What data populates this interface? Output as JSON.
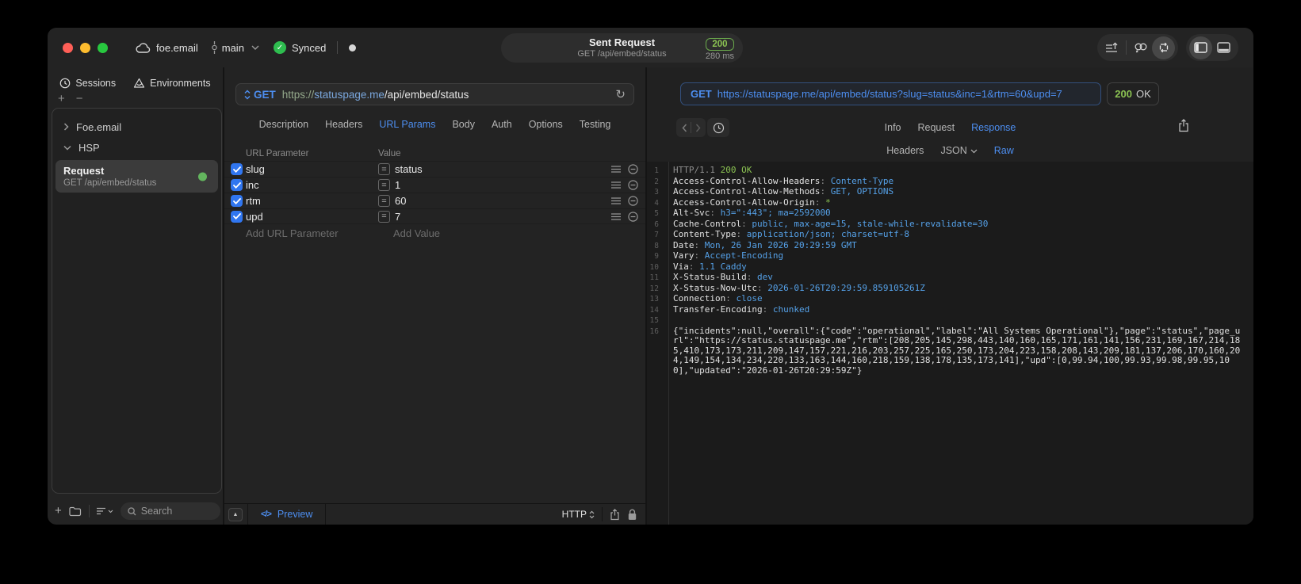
{
  "titlebar": {
    "project_name": "foe.email",
    "branch_name": "main",
    "sync_label": "Synced",
    "request_title": "Sent Request",
    "request_subtitle": "GET /api/embed/status",
    "status_code": "200",
    "duration": "280 ms"
  },
  "sidebar": {
    "tabs": [
      {
        "label": "Sessions"
      },
      {
        "label": "Environments"
      }
    ],
    "tree": [
      {
        "label": "Foe.email",
        "expanded": false
      },
      {
        "label": "HSP",
        "expanded": true
      }
    ],
    "request_item": {
      "title": "Request",
      "subtitle": "GET /api/embed/status"
    },
    "search_placeholder": "Search"
  },
  "request_editor": {
    "method": "GET",
    "url": {
      "scheme": "https://",
      "host": "statuspage.me",
      "path": "/api/embed/status"
    },
    "tabs": [
      "Description",
      "Headers",
      "URL Params",
      "Body",
      "Auth",
      "Options",
      "Testing"
    ],
    "active_tab": "URL Params",
    "params_table": {
      "columns": [
        "URL Parameter",
        "Value"
      ],
      "rows": [
        {
          "name": "slug",
          "value": "status",
          "checked": true
        },
        {
          "name": "inc",
          "value": "1",
          "checked": true
        },
        {
          "name": "rtm",
          "value": "60",
          "checked": true
        },
        {
          "name": "upd",
          "value": "7",
          "checked": true
        }
      ],
      "add_name_placeholder": "Add URL Parameter",
      "add_value_placeholder": "Add Value"
    },
    "footer": {
      "preview_label": "Preview",
      "code_glyph": "</>",
      "protocol_label": "HTTP"
    }
  },
  "response_viewer": {
    "request_line": {
      "method": "GET",
      "url": "https://statuspage.me/api/embed/status?slug=status&inc=1&rtm=60&upd=7"
    },
    "status_code": "200",
    "status_text": "OK",
    "tabs": [
      "Info",
      "Request",
      "Response"
    ],
    "active_tab": "Response",
    "view_tabs": [
      "Headers",
      "JSON",
      "Raw"
    ],
    "active_view_tab": "Raw",
    "body_lines": [
      {
        "n": "1",
        "segs": [
          {
            "t": "HTTP/1.1 ",
            "c": "dim"
          },
          {
            "t": "200 OK",
            "c": "green"
          }
        ]
      },
      {
        "n": "2",
        "segs": [
          {
            "t": "Access-Control-Allow-Headers",
            "c": "key"
          },
          {
            "t": ": ",
            "c": "dim"
          },
          {
            "t": "Content-Type",
            "c": "val"
          }
        ]
      },
      {
        "n": "3",
        "segs": [
          {
            "t": "Access-Control-Allow-Methods",
            "c": "key"
          },
          {
            "t": ": ",
            "c": "dim"
          },
          {
            "t": "GET, OPTIONS",
            "c": "val"
          }
        ]
      },
      {
        "n": "4",
        "segs": [
          {
            "t": "Access-Control-Allow-Origin",
            "c": "key"
          },
          {
            "t": ": ",
            "c": "dim"
          },
          {
            "t": "*",
            "c": "green"
          }
        ]
      },
      {
        "n": "5",
        "segs": [
          {
            "t": "Alt-Svc",
            "c": "key"
          },
          {
            "t": ": ",
            "c": "dim"
          },
          {
            "t": "h3=\":443\"; ma=2592000",
            "c": "val"
          }
        ]
      },
      {
        "n": "6",
        "segs": [
          {
            "t": "Cache-Control",
            "c": "key"
          },
          {
            "t": ": ",
            "c": "dim"
          },
          {
            "t": "public, max-age=15, stale-while-revalidate=30",
            "c": "val"
          }
        ]
      },
      {
        "n": "7",
        "segs": [
          {
            "t": "Content-Type",
            "c": "key"
          },
          {
            "t": ": ",
            "c": "dim"
          },
          {
            "t": "application/json; charset=utf-8",
            "c": "val"
          }
        ]
      },
      {
        "n": "8",
        "segs": [
          {
            "t": "Date",
            "c": "key"
          },
          {
            "t": ": ",
            "c": "dim"
          },
          {
            "t": "Mon, 26 Jan 2026 20:29:59 GMT",
            "c": "val"
          }
        ]
      },
      {
        "n": "9",
        "segs": [
          {
            "t": "Vary",
            "c": "key"
          },
          {
            "t": ": ",
            "c": "dim"
          },
          {
            "t": "Accept-Encoding",
            "c": "val"
          }
        ]
      },
      {
        "n": "10",
        "segs": [
          {
            "t": "Via",
            "c": "key"
          },
          {
            "t": ": ",
            "c": "dim"
          },
          {
            "t": "1.1 Caddy",
            "c": "val"
          }
        ]
      },
      {
        "n": "11",
        "segs": [
          {
            "t": "X-Status-Build",
            "c": "key"
          },
          {
            "t": ": ",
            "c": "dim"
          },
          {
            "t": "dev",
            "c": "val"
          }
        ]
      },
      {
        "n": "12",
        "segs": [
          {
            "t": "X-Status-Now-Utc",
            "c": "key"
          },
          {
            "t": ": ",
            "c": "dim"
          },
          {
            "t": "2026-01-26T20:29:59.859105261Z",
            "c": "val"
          }
        ]
      },
      {
        "n": "13",
        "segs": [
          {
            "t": "Connection",
            "c": "key"
          },
          {
            "t": ": ",
            "c": "dim"
          },
          {
            "t": "close",
            "c": "val"
          }
        ]
      },
      {
        "n": "14",
        "segs": [
          {
            "t": "Transfer-Encoding",
            "c": "key"
          },
          {
            "t": ": ",
            "c": "dim"
          },
          {
            "t": "chunked",
            "c": "val"
          }
        ]
      },
      {
        "n": "15",
        "segs": []
      },
      {
        "n": "16",
        "segs": [
          {
            "t": "{\"incidents\":null,\"overall\":{\"code\":\"operational\",\"label\":\"All Systems Operational\"},\"page\":\"status\",\"page_url\":\"https://status.statuspage.me\",\"rtm\":[208,205,145,298,443,140,160,165,171,161,141,156,231,169,167,214,185,410,173,173,211,209,147,157,221,216,203,257,225,165,250,173,204,223,158,208,143,209,181,137,206,170,160,204,149,154,134,234,220,133,163,144,160,218,159,138,178,135,173,141],\"upd\":[0,99.94,100,99.93,99.98,99.95,100],\"updated\":\"2026-01-26T20:29:59Z\"}",
            "c": "key"
          }
        ]
      }
    ]
  },
  "colors": {
    "accent_blue": "#4d8ef0",
    "status_green": "#8bc252",
    "value_blue": "#55a1e8",
    "checkbox_blue": "#3076f0"
  }
}
